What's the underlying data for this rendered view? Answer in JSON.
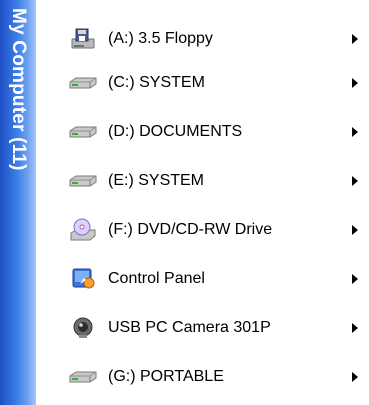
{
  "panel": {
    "title": "My Computer (11)"
  },
  "items": [
    {
      "label": "(A:) 3.5 Floppy",
      "icon": "floppy-drive-icon"
    },
    {
      "label": "(C:) SYSTEM",
      "icon": "hard-drive-icon"
    },
    {
      "label": "(D:) DOCUMENTS",
      "icon": "hard-drive-icon"
    },
    {
      "label": "(E:) SYSTEM",
      "icon": "hard-drive-icon"
    },
    {
      "label": "(F:) DVD/CD-RW Drive",
      "icon": "optical-drive-icon"
    },
    {
      "label": "Control Panel",
      "icon": "control-panel-icon"
    },
    {
      "label": "USB PC Camera 301P",
      "icon": "camera-icon"
    },
    {
      "label": "(G:) PORTABLE",
      "icon": "hard-drive-icon"
    }
  ],
  "colors": {
    "side_band": "#3b7be6",
    "background": "#ffffff",
    "text": "#000000"
  }
}
